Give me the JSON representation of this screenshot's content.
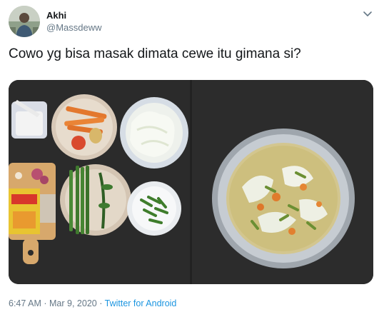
{
  "tweet": {
    "display_name": "Akhi",
    "username": "@Massdeww",
    "text": "Cowo yg bisa masak dimata cewe itu gimana si?",
    "time": "6:47 AM",
    "separator": "·",
    "date": "Mar 9, 2020",
    "source": "Twitter for Android"
  },
  "photos": [
    {
      "name": "raw-ingredients-photo",
      "description_icon": "photo-icon"
    },
    {
      "name": "cooked-soup-photo",
      "description_icon": "photo-icon"
    }
  ],
  "icons": {
    "menu": "chevron-down-icon",
    "avatar": "avatar"
  },
  "colors": {
    "link": "#1b95e0",
    "secondary_text": "#657786",
    "primary_text": "#14171a"
  }
}
